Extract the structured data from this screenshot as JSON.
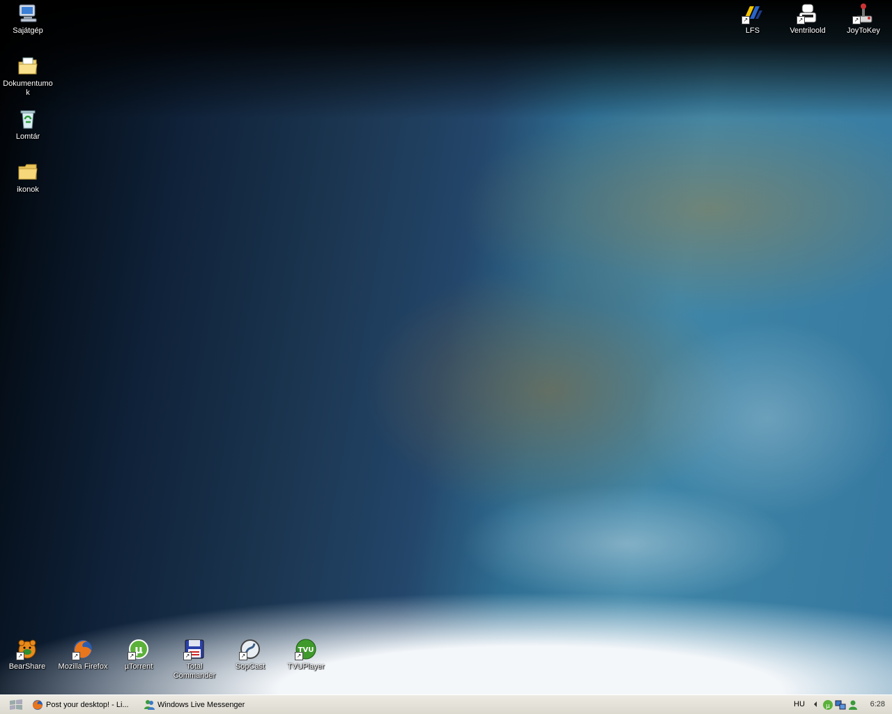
{
  "desktop_icons": {
    "my_computer": {
      "label": "Sajátgép"
    },
    "documents": {
      "label": "Dokumentumok"
    },
    "recycle_bin": {
      "label": "Lomtár"
    },
    "ikonok": {
      "label": "ikonok"
    },
    "lfs": {
      "label": "LFS"
    },
    "ventrilo": {
      "label": "Ventriloold"
    },
    "joytokey": {
      "label": "JoyToKey"
    },
    "bearshare": {
      "label": "BearShare"
    },
    "firefox": {
      "label": "Mozilla Firefox"
    },
    "utorrent": {
      "label": "µTorrent"
    },
    "total_commander": {
      "label": "Total Commander"
    },
    "sopcast": {
      "label": "SopCast"
    },
    "tvuplayer": {
      "label": "TVUPlayer"
    }
  },
  "taskbar": {
    "tasks": [
      {
        "label": "Post your desktop! - Li...",
        "icon": "firefox-icon"
      },
      {
        "label": "Windows Live Messenger",
        "icon": "messenger-icon"
      }
    ],
    "language": "HU",
    "clock": "6:28"
  },
  "colors": {
    "taskbar": "#dcd9cf",
    "label_text": "#ffffff"
  }
}
